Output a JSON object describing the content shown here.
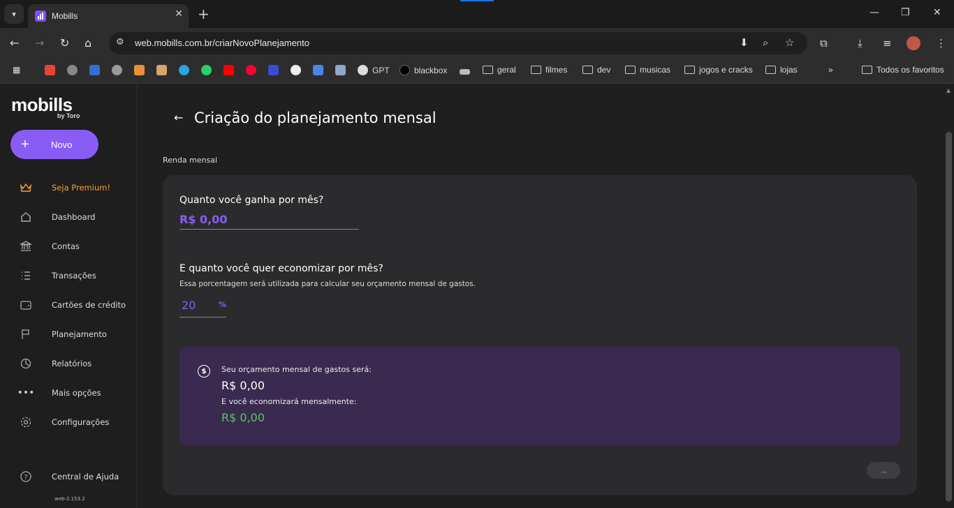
{
  "browser": {
    "tab_title": "Mobills",
    "url": "web.mobills.com.br/criarNovoPlanejamento",
    "bookmarks": [
      "GPT",
      "blackbox",
      "geral",
      "filmes",
      "dev",
      "musicas",
      "jogos e cracks",
      "lojas"
    ],
    "all_bookmarks": "Todos os favoritos"
  },
  "sidebar": {
    "logo": "mobills",
    "logo_sub": "by Toro",
    "new_button": "Novo",
    "items": [
      {
        "label": "Seja Premium!"
      },
      {
        "label": "Dashboard"
      },
      {
        "label": "Contas"
      },
      {
        "label": "Transações"
      },
      {
        "label": "Cartões de crédito"
      },
      {
        "label": "Planejamento"
      },
      {
        "label": "Relatórios"
      },
      {
        "label": "Mais opções"
      },
      {
        "label": "Configurações"
      },
      {
        "label": "Central de Ajuda"
      }
    ],
    "version": "web-2.153.2"
  },
  "main": {
    "title": "Criação do planejamento mensal",
    "section": "Renda mensal",
    "income_question": "Quanto você ganha por mês?",
    "income_value": "R$ 0,00",
    "savings_question": "E quanto você quer economizar por mês?",
    "savings_hint": "Essa porcentagem será utilizada para calcular seu orçamento mensal de gastos.",
    "savings_percent": "20",
    "percent_symbol": "%",
    "summary": {
      "budget_label": "Seu orçamento mensal de gastos será:",
      "budget_value": "R$ 0,00",
      "savings_label": "E você economizará mensalmente:",
      "savings_value": "R$ 0,00",
      "coin_symbol": "$"
    },
    "next_arrow": "→"
  },
  "colors": {
    "accent": "#8a5cf6",
    "premium": "#f2a03d",
    "savings_green": "#5fc26a",
    "summary_bg": "#3a2a50"
  }
}
